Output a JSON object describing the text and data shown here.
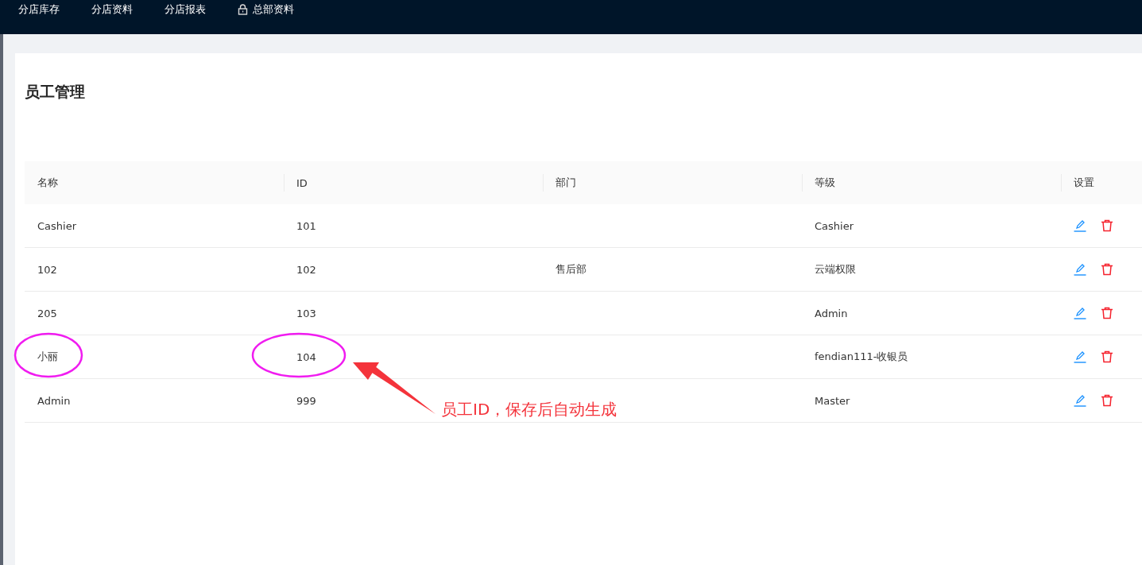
{
  "nav": {
    "items": [
      {
        "label": "分店库存",
        "locked": false
      },
      {
        "label": "分店资料",
        "locked": false
      },
      {
        "label": "分店报表",
        "locked": false
      },
      {
        "label": "总部资料",
        "locked": true
      }
    ]
  },
  "page": {
    "title": "员工管理"
  },
  "table": {
    "columns": [
      "名称",
      "ID",
      "部门",
      "等级",
      "设置"
    ],
    "rows": [
      {
        "cells": [
          "Cashier",
          "101",
          "",
          "Cashier"
        ]
      },
      {
        "cells": [
          "102",
          "102",
          "售后部",
          "云端权限"
        ]
      },
      {
        "cells": [
          "205",
          "103",
          "",
          "Admin"
        ]
      },
      {
        "cells": [
          "小丽",
          "104",
          "",
          "fendian111-收银员"
        ]
      },
      {
        "cells": [
          "Admin",
          "999",
          "",
          "Master"
        ]
      }
    ]
  },
  "annotation": {
    "text": "员工ID，保存后自动生成"
  }
}
